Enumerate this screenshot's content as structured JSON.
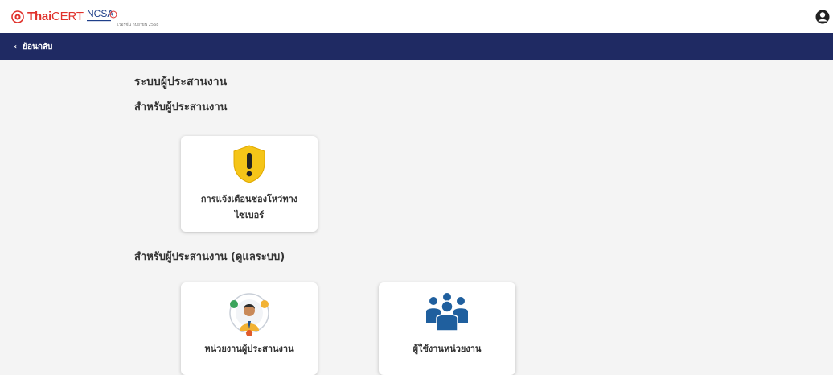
{
  "header": {
    "brand_thai": "Thai",
    "brand_cert": "CERT",
    "ncsa_text": "NCSA",
    "version": "เวอร์ชั่น กันยายน 2568"
  },
  "nav": {
    "back_label": "ย้อนกลับ",
    "back_icon": "chevron-left"
  },
  "main": {
    "title": "ระบบผู้ประสานงาน",
    "section1": {
      "heading": "สำหรับผู้ประสานงาน",
      "cards": [
        {
          "label_line1": "การแจ้งเตือนช่องโหว่ทาง",
          "label_line2": "ไซเบอร์",
          "icon": "warning-shield-icon"
        }
      ]
    },
    "section2": {
      "heading": "สำหรับผู้ประสานงาน (ดูแลระบบ)",
      "cards": [
        {
          "label": "หน่วยงานผู้ประสานงาน",
          "icon": "coordinator-agency-icon"
        },
        {
          "label": "ผู้ใช้งานหน่วยงาน",
          "icon": "agency-users-icon"
        }
      ]
    }
  },
  "colors": {
    "nav_bg": "#1f2a63",
    "page_bg": "#f4f4f4",
    "shield_yellow": "#f5c518",
    "users_blue": "#1f5f9e",
    "brand_red": "#e0312b"
  }
}
